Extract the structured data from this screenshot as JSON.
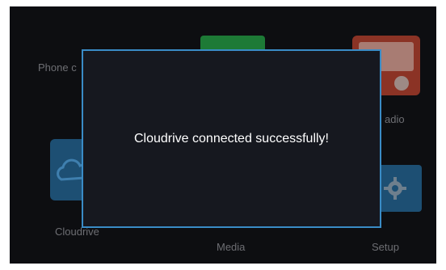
{
  "home": {
    "tiles": {
      "phone": "Phone c",
      "radio": "adio",
      "cloudrive": "Cloudrive",
      "media": "Media",
      "setup": "Setup"
    }
  },
  "dialog": {
    "message": "Cloudrive connected successfully!"
  },
  "colors": {
    "dialog_border": "#3a8cc6",
    "background": "#0a0a0c",
    "media_icon": "#1d7a36",
    "radio_icon": "#8b3325",
    "tile_blue": "#1d4f73"
  },
  "icons": {
    "media": "media-icon",
    "radio": "radio-icon",
    "cloudrive": "cloud-icon",
    "setup": "gear-icon"
  }
}
